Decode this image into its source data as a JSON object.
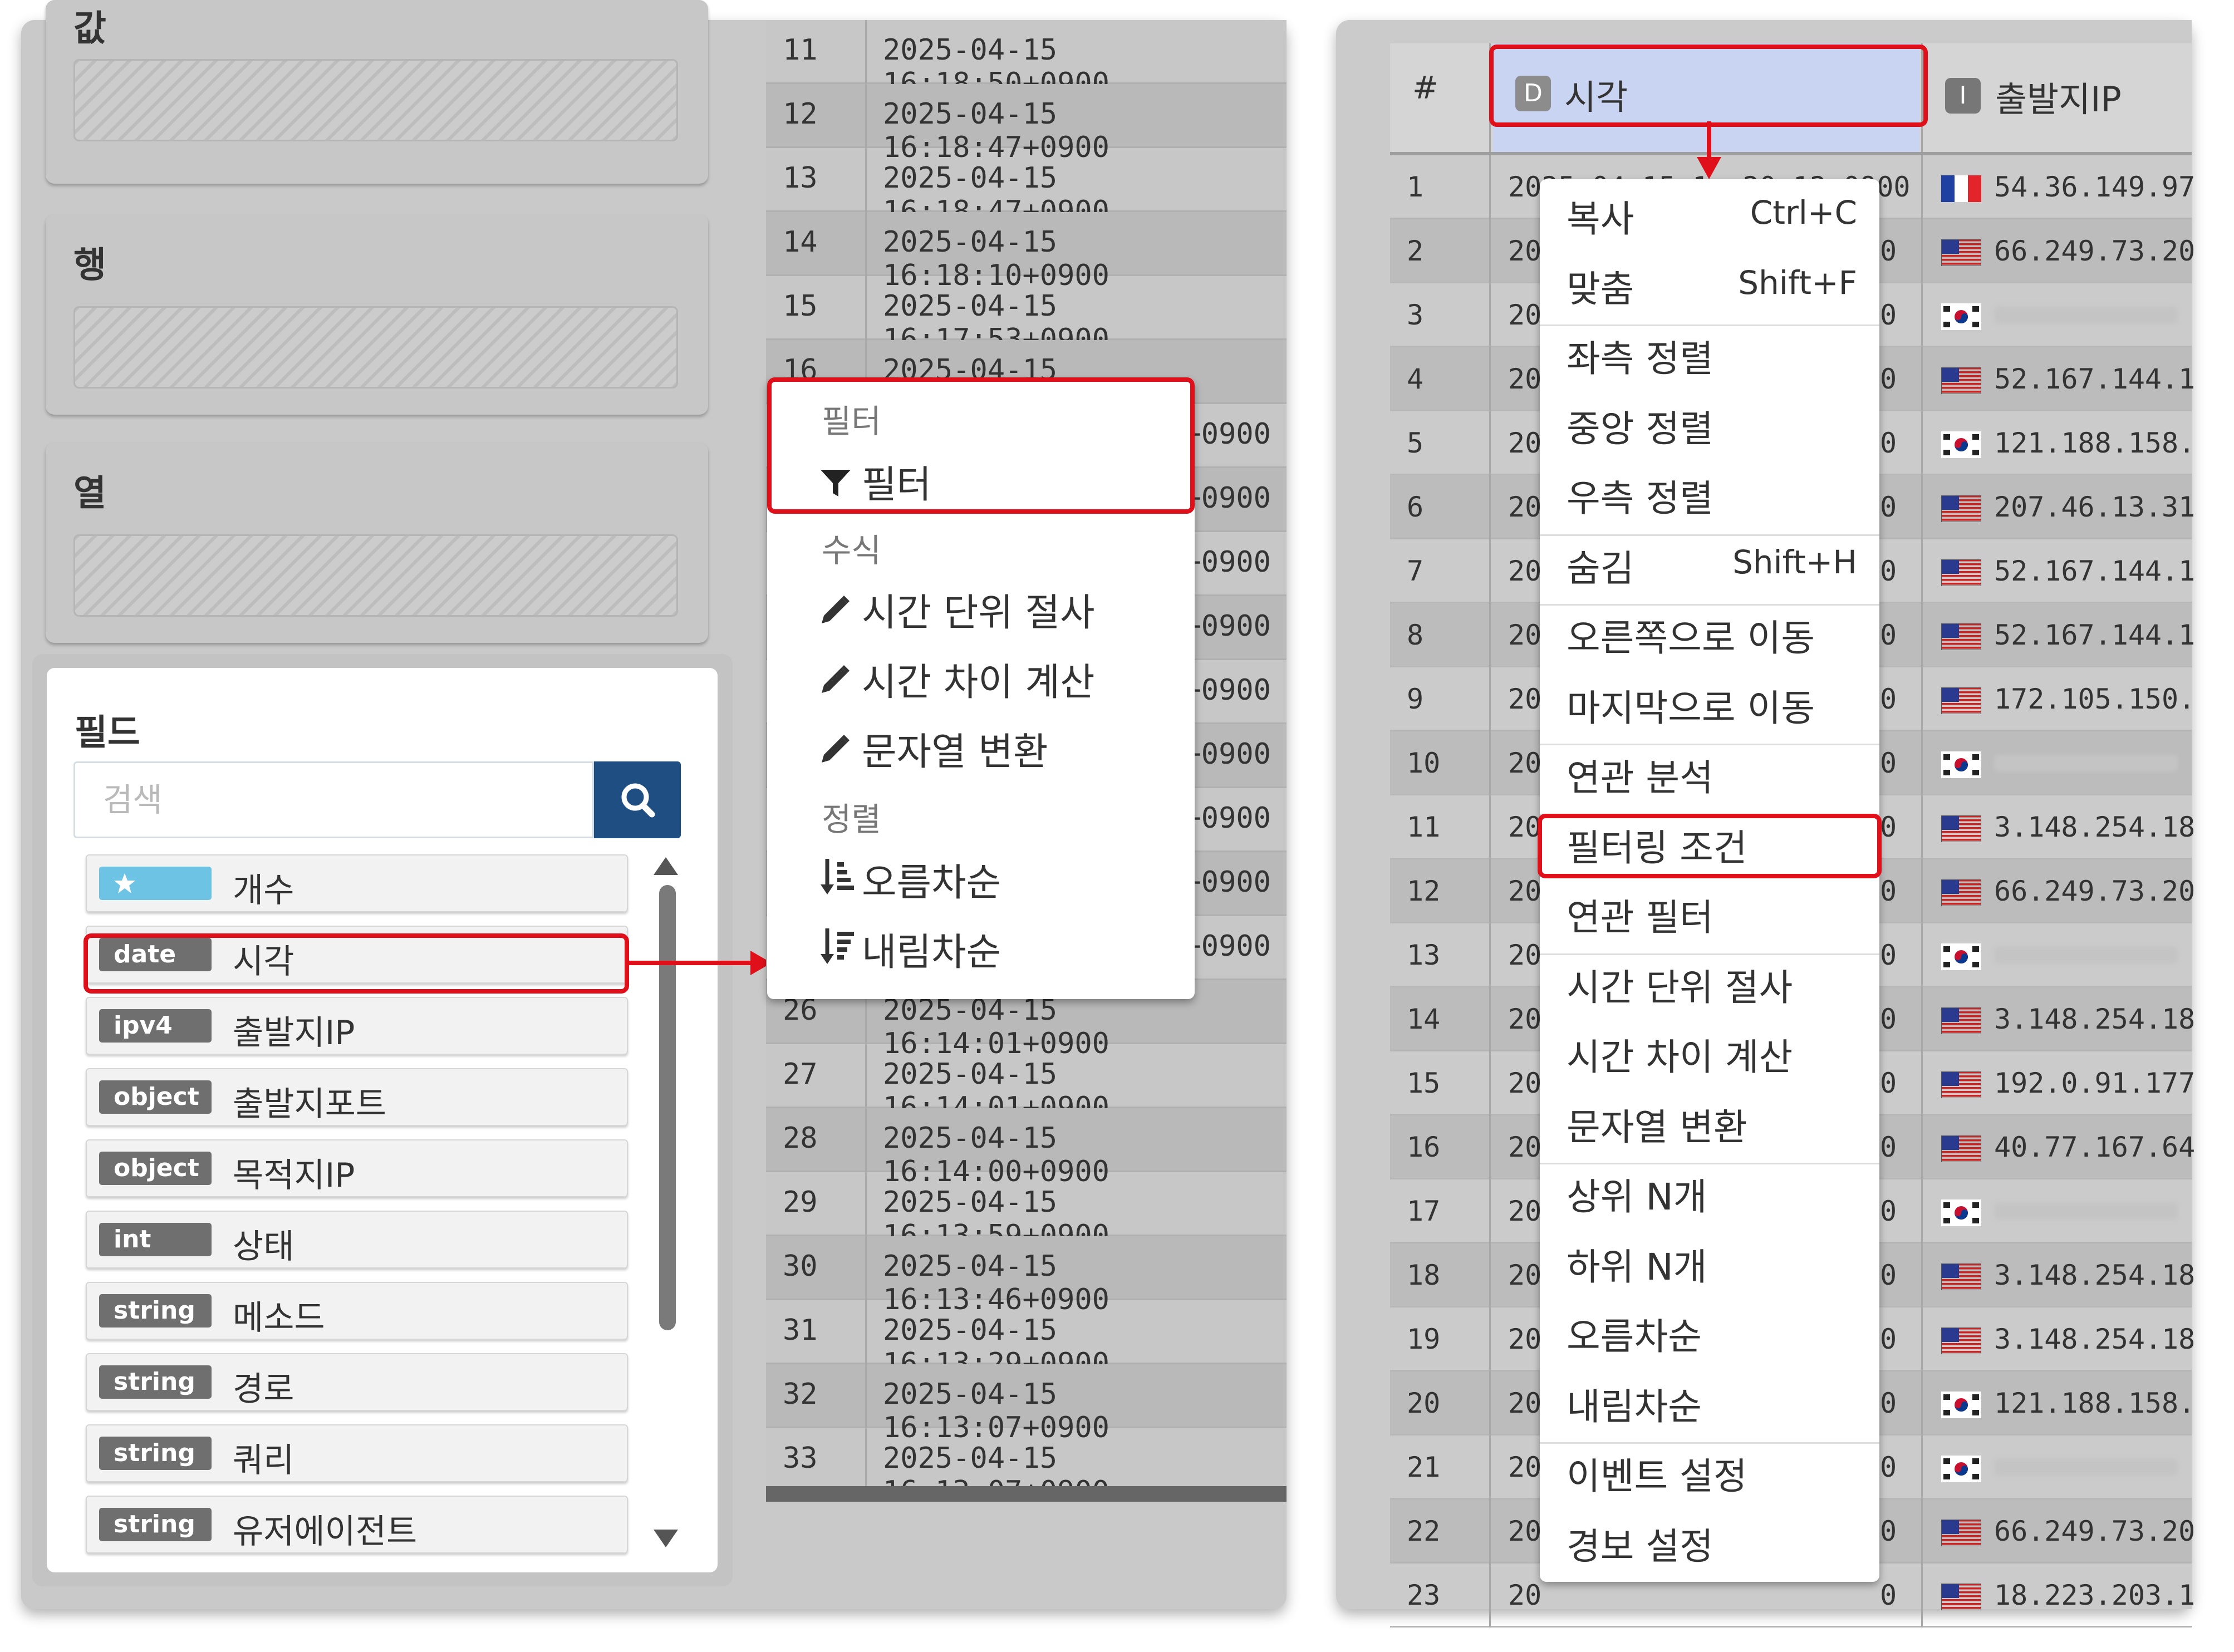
{
  "left_panel": {
    "slots": [
      {
        "title": "값"
      },
      {
        "title": "행"
      },
      {
        "title": "열"
      }
    ],
    "field_panel": {
      "title": "필드",
      "search_placeholder": "검색",
      "items": [
        {
          "type": "",
          "type_icon": "star-icon",
          "name": "개수"
        },
        {
          "type": "date",
          "name": "시각"
        },
        {
          "type": "ipv4",
          "name": "출발지IP"
        },
        {
          "type": "object",
          "name": "출발지포트"
        },
        {
          "type": "object",
          "name": "목적지IP"
        },
        {
          "type": "int",
          "name": "상태"
        },
        {
          "type": "string",
          "name": "메소드"
        },
        {
          "type": "string",
          "name": "경로"
        },
        {
          "type": "string",
          "name": "쿼리"
        },
        {
          "type": "string",
          "name": "유저에이전트"
        }
      ]
    }
  },
  "left_table": {
    "rows": [
      {
        "n": "11",
        "time": "2025-04-15 16:18:50+0900"
      },
      {
        "n": "12",
        "time": "2025-04-15 16:18:47+0900"
      },
      {
        "n": "13",
        "time": "2025-04-15 16:18:47+0900"
      },
      {
        "n": "14",
        "time": "2025-04-15 16:18:10+0900"
      },
      {
        "n": "15",
        "time": "2025-04-15 16:17:53+0900"
      },
      {
        "n": "16",
        "time": "2025-04-15 16:17:46+0900"
      },
      {
        "n": "",
        "time": "+0900"
      },
      {
        "n": "",
        "time": "+0900"
      },
      {
        "n": "",
        "time": "+0900"
      },
      {
        "n": "",
        "time": "+0900"
      },
      {
        "n": "",
        "time": "+0900"
      },
      {
        "n": "",
        "time": "+0900"
      },
      {
        "n": "",
        "time": "+0900"
      },
      {
        "n": "",
        "time": "+0900"
      },
      {
        "n": "",
        "time": "+0900"
      },
      {
        "n": "26",
        "time": "2025-04-15 16:14:01+0900"
      },
      {
        "n": "27",
        "time": "2025-04-15 16:14:01+0900"
      },
      {
        "n": "28",
        "time": "2025-04-15 16:14:00+0900"
      },
      {
        "n": "29",
        "time": "2025-04-15 16:13:59+0900"
      },
      {
        "n": "30",
        "time": "2025-04-15 16:13:46+0900"
      },
      {
        "n": "31",
        "time": "2025-04-15 16:13:29+0900"
      },
      {
        "n": "32",
        "time": "2025-04-15 16:13:07+0900"
      },
      {
        "n": "33",
        "time": "2025-04-15 16:13:07+0900"
      }
    ]
  },
  "field_menu": {
    "filter_header": "필터",
    "filter_item": "필터",
    "formula_header": "수식",
    "formula_items": [
      "시간 단위 절사",
      "시간 차이 계산",
      "문자열 변환"
    ],
    "sort_header": "정렬",
    "sort_items": [
      "오름차순",
      "내림차순"
    ]
  },
  "right_table": {
    "header": {
      "num": "#",
      "col1_type": "D",
      "col1": "시각",
      "col2_type": "I",
      "col2": "출발지IP"
    },
    "first_row_time": "2025-04-15 1 :20:12+0900",
    "row_time_prefix": "20",
    "row_time_suffix": "0",
    "rows": [
      {
        "n": "1",
        "flag": "fr",
        "ip": "54.36.149.97"
      },
      {
        "n": "2",
        "flag": "us",
        "ip": "66.249.73.20"
      },
      {
        "n": "3",
        "flag": "kr",
        "ip": ""
      },
      {
        "n": "4",
        "flag": "us",
        "ip": "52.167.144.1"
      },
      {
        "n": "5",
        "flag": "kr",
        "ip": "121.188.158."
      },
      {
        "n": "6",
        "flag": "us",
        "ip": "207.46.13.31"
      },
      {
        "n": "7",
        "flag": "us",
        "ip": "52.167.144.1"
      },
      {
        "n": "8",
        "flag": "us",
        "ip": "52.167.144.1"
      },
      {
        "n": "9",
        "flag": "us",
        "ip": "172.105.150."
      },
      {
        "n": "10",
        "flag": "kr",
        "ip": ""
      },
      {
        "n": "11",
        "flag": "us",
        "ip": "3.148.254.18"
      },
      {
        "n": "12",
        "flag": "us",
        "ip": "66.249.73.20"
      },
      {
        "n": "13",
        "flag": "kr",
        "ip": ""
      },
      {
        "n": "14",
        "flag": "us",
        "ip": "3.148.254.18"
      },
      {
        "n": "15",
        "flag": "us",
        "ip": "192.0.91.177"
      },
      {
        "n": "16",
        "flag": "us",
        "ip": "40.77.167.64"
      },
      {
        "n": "17",
        "flag": "kr",
        "ip": ""
      },
      {
        "n": "18",
        "flag": "us",
        "ip": "3.148.254.18"
      },
      {
        "n": "19",
        "flag": "us",
        "ip": "3.148.254.18"
      },
      {
        "n": "20",
        "flag": "kr",
        "ip": "121.188.158."
      },
      {
        "n": "21",
        "flag": "kr",
        "ip": ""
      },
      {
        "n": "22",
        "flag": "us",
        "ip": "66.249.73.20"
      },
      {
        "n": "23",
        "flag": "us",
        "ip": "18.223.203.1"
      }
    ]
  },
  "column_menu": {
    "items": [
      {
        "label": "복사",
        "shortcut": "Ctrl+C"
      },
      {
        "label": "맞춤",
        "shortcut": "Shift+F"
      },
      {
        "label": "좌측 정렬",
        "shortcut": ""
      },
      {
        "label": "중앙 정렬",
        "shortcut": ""
      },
      {
        "label": "우측 정렬",
        "shortcut": ""
      },
      {
        "label": "숨김",
        "shortcut": "Shift+H"
      },
      {
        "label": "오른쪽으로 이동",
        "shortcut": ""
      },
      {
        "label": "마지막으로 이동",
        "shortcut": ""
      },
      {
        "label": "연관 분석",
        "shortcut": ""
      },
      {
        "label": "필터링 조건",
        "shortcut": ""
      },
      {
        "label": "연관 필터",
        "shortcut": ""
      },
      {
        "label": "시간 단위 절사",
        "shortcut": ""
      },
      {
        "label": "시간 차이 계산",
        "shortcut": ""
      },
      {
        "label": "문자열 변환",
        "shortcut": ""
      },
      {
        "label": "상위 N개",
        "shortcut": ""
      },
      {
        "label": "하위 N개",
        "shortcut": ""
      },
      {
        "label": "오름차순",
        "shortcut": ""
      },
      {
        "label": "내림차순",
        "shortcut": ""
      },
      {
        "label": "이벤트 설정",
        "shortcut": ""
      },
      {
        "label": "경보 설정",
        "shortcut": ""
      }
    ]
  },
  "colors": {
    "highlight": "#e0101a",
    "search_button": "#1f4f82",
    "star_badge": "#6cc3e3",
    "header_selected": "#c9d3f2"
  }
}
